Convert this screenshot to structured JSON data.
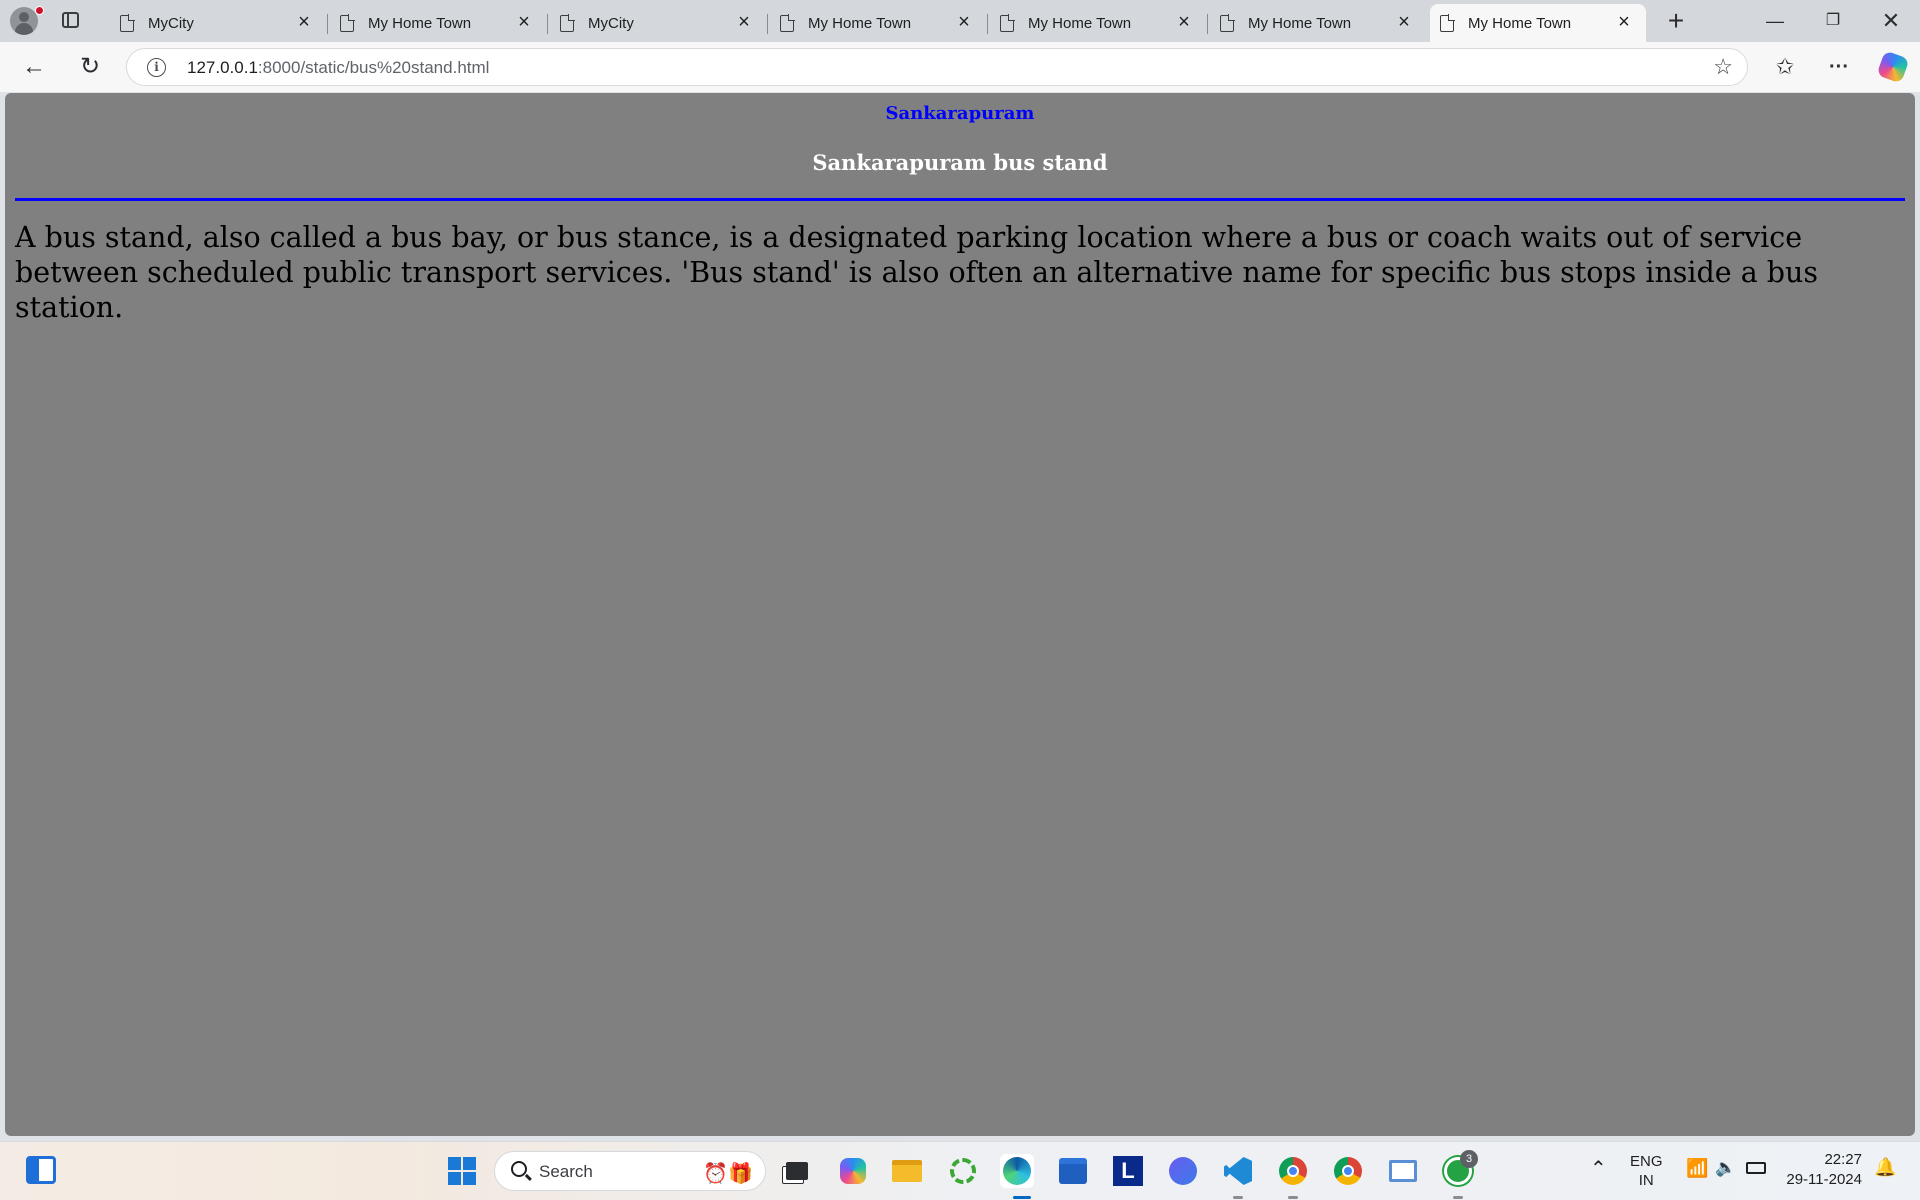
{
  "browser": {
    "tabs": [
      {
        "label": "MyCity",
        "active": false
      },
      {
        "label": "My Home Town",
        "active": false
      },
      {
        "label": "MyCity",
        "active": false
      },
      {
        "label": "My Home Town",
        "active": false
      },
      {
        "label": "My Home Town",
        "active": false
      },
      {
        "label": "My Home Town",
        "active": false
      },
      {
        "label": "My Home Town",
        "active": true
      }
    ],
    "url_host": "127.0.0.1",
    "url_rest": ":8000/static/bus%20stand.html",
    "icons": [
      "profile-icon",
      "tab-actions-icon",
      "page-icon",
      "close-icon",
      "new-tab-icon",
      "minimize-icon",
      "restore-icon",
      "window-close-icon",
      "back-icon",
      "refresh-icon",
      "site-info-icon",
      "favorite-star-icon",
      "favorites-icon",
      "more-icon",
      "copilot-icon"
    ]
  },
  "page": {
    "site_title": "Sankarapuram",
    "heading": "Sankarapuram bus stand",
    "body": "A bus stand, also called a bus bay, or bus stance, is a designated parking location where a bus or coach waits out of service between scheduled public transport services. 'Bus stand' is also often an alternative name for specific bus stops inside a bus station.",
    "colors": {
      "background": "#808080",
      "site_title": "#0000ff",
      "heading": "#ffffff",
      "rule": "#0000ff"
    }
  },
  "taskbar": {
    "search_label": "Search",
    "lang_top": "ENG",
    "lang_bottom": "IN",
    "time": "22:27",
    "date": "29-11-2024",
    "whatsapp_badge": "3"
  }
}
